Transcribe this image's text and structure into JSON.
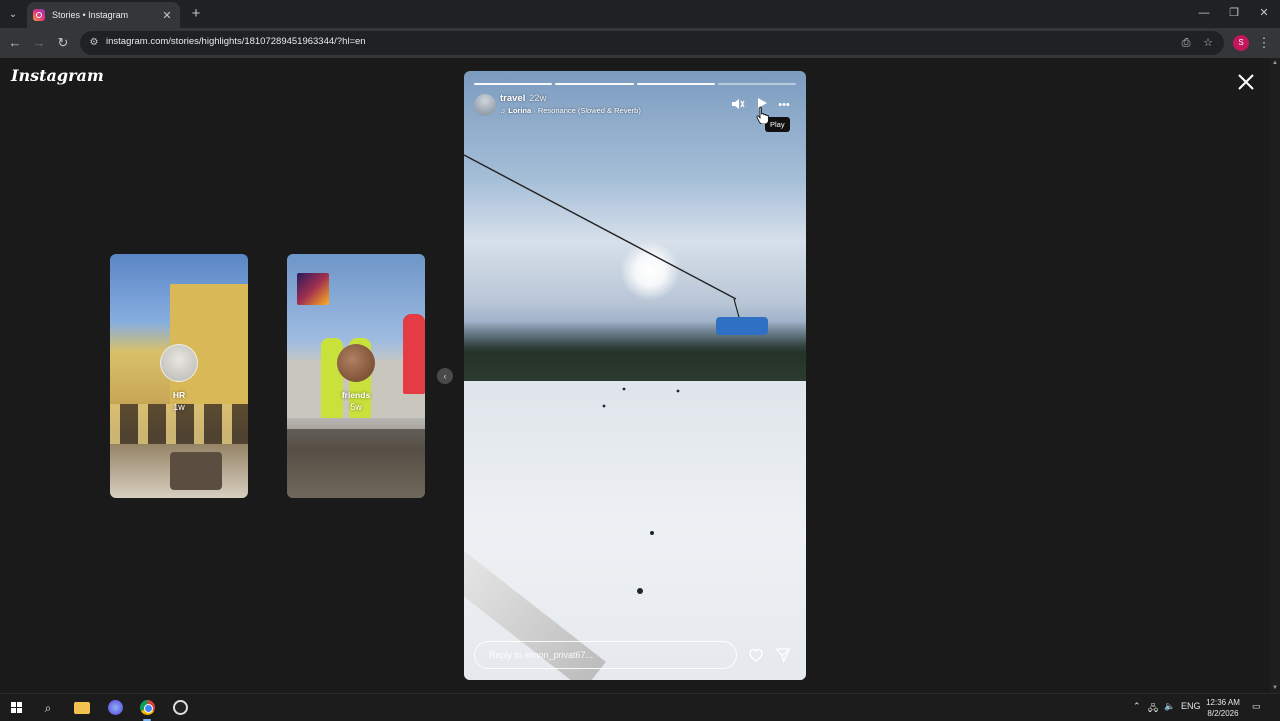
{
  "browser": {
    "tab_title": "Stories • Instagram",
    "url": "instagram.com/stories/highlights/18107289451963344/?hl=en",
    "profile_initial": "S",
    "icons": {
      "tab_list": "chevron-down-icon",
      "tab_close": "close-icon",
      "new_tab": "plus-icon",
      "back": "arrow-left-icon",
      "forward": "arrow-right-icon",
      "reload": "reload-icon",
      "site_info": "tune-icon",
      "install": "install-icon",
      "bookmark": "star-icon",
      "menu": "kebab-icon"
    }
  },
  "page": {
    "logo_text": "Instagram",
    "previews": [
      {
        "name": "HR",
        "age": "1w"
      },
      {
        "name": "friends",
        "age": "5w"
      }
    ]
  },
  "story": {
    "username": "travel",
    "time_ago": "22w",
    "music_artist": "Lorina",
    "music_separator": " · ",
    "music_track": "Resonance (Slowed & Reverb)",
    "tooltip": "Play",
    "reply_placeholder": "Reply to simon_privat67...",
    "progress": {
      "segments": 4,
      "completed": 3
    }
  },
  "taskbar": {
    "language": "ENG",
    "time": "12:36 AM",
    "date": "8/2/2026"
  },
  "colors": {
    "background": "#1a1a1a",
    "chrome_dark": "#202124",
    "chrome_toolbar": "#35363a",
    "profile": "#c2185b"
  }
}
